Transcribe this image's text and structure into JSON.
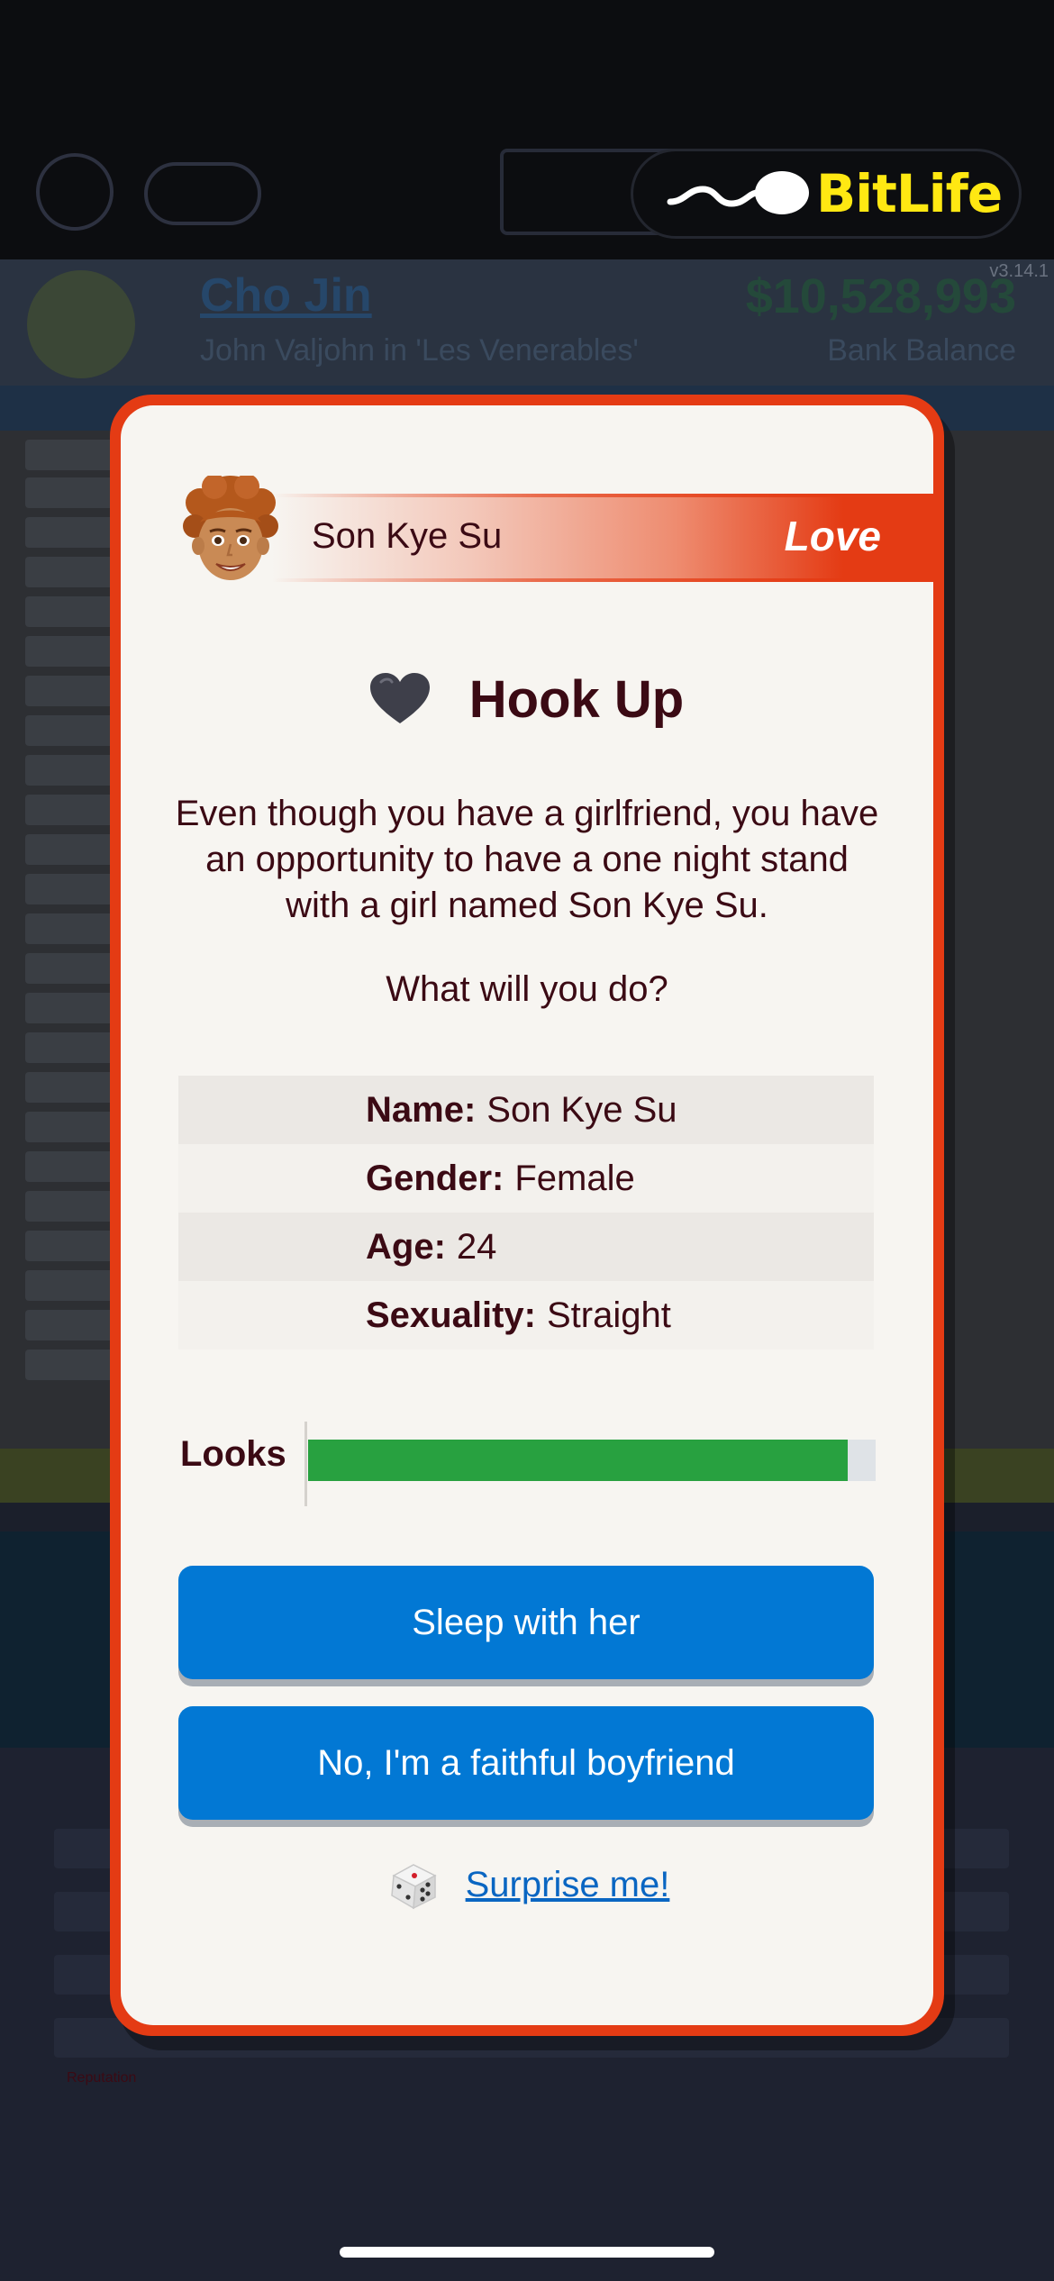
{
  "app": {
    "brand_name": "BitLife",
    "version": "v3.14.1"
  },
  "background": {
    "character_name": "Cho Jin",
    "character_subtitle": "John Valjohn in 'Les Venerables'",
    "bank_balance": "$10,528,993",
    "bank_balance_label": "Bank Balance",
    "reputation_label": "Reputation"
  },
  "popup": {
    "person_name": "Son Kye Su",
    "category": "Love",
    "title": "Hook Up",
    "description": "Even though you have a girlfriend, you have an opportunity to have a one night stand with a girl named Son Kye Su.",
    "question": "What will you do?",
    "info": [
      {
        "label": "Name:",
        "value": "Son Kye Su"
      },
      {
        "label": "Gender:",
        "value": "Female"
      },
      {
        "label": "Age:",
        "value": "24"
      },
      {
        "label": "Sexuality:",
        "value": "Straight"
      }
    ],
    "looks": {
      "label": "Looks",
      "percent": 95
    },
    "choices": [
      {
        "label": "Sleep with her"
      },
      {
        "label": "No, I'm a faithful boyfriend"
      }
    ],
    "surprise_label": "Surprise me!"
  },
  "colors": {
    "accent_red": "#e43b14",
    "button_blue": "#0278d4",
    "looks_green": "#28a140",
    "brand_yellow": "#ffe812"
  },
  "icons": {
    "heart": "heart-icon",
    "dice": "dice-icon",
    "sperm_logo": "sperm-logo-icon"
  }
}
